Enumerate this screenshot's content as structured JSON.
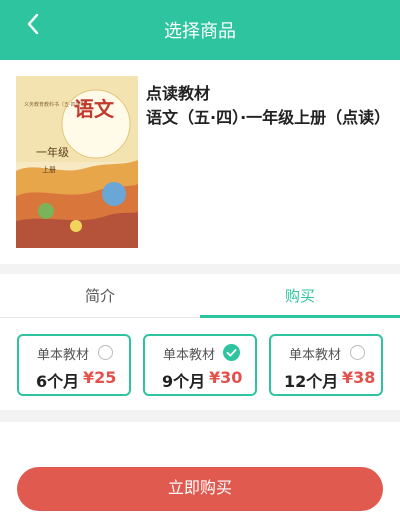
{
  "header": {
    "title": "选择商品"
  },
  "product": {
    "type_label": "点读教材",
    "name": "语文（五·四）·一年级上册（点读）",
    "cover": {
      "series_text": "义务教育教科书（五·四学制）",
      "subject": "语文",
      "grade": "一年级",
      "volume": "上册"
    }
  },
  "tabs": [
    {
      "label": "简介",
      "active": false
    },
    {
      "label": "购买",
      "active": true
    }
  ],
  "options": [
    {
      "label": "单本教材",
      "period": "6个月",
      "price": "¥25",
      "selected": false
    },
    {
      "label": "单本教材",
      "period": "9个月",
      "price": "¥30",
      "selected": true
    },
    {
      "label": "单本教材",
      "period": "12个月",
      "price": "¥38",
      "selected": false
    }
  ],
  "footer": {
    "buy_label": "立即购买"
  },
  "colors": {
    "accent": "#2fc4a0",
    "price": "#e4504a",
    "buy_button": "#e05a50"
  }
}
